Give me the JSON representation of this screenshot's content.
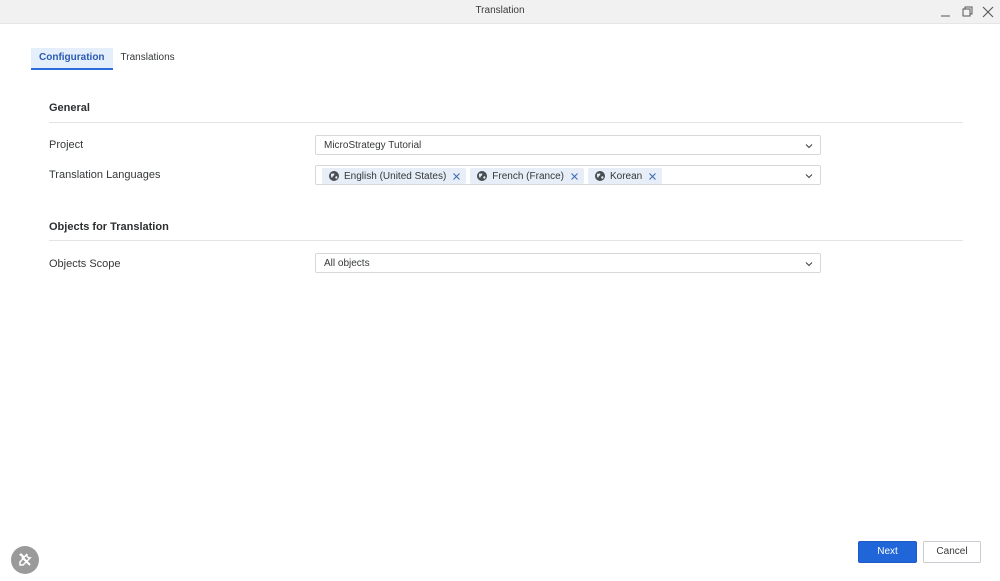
{
  "window": {
    "title": "Translation",
    "controls": [
      "minimize-icon",
      "restore-icon",
      "close-icon"
    ]
  },
  "tabs": [
    {
      "label": "Configuration",
      "active": true
    },
    {
      "label": "Translations",
      "active": false
    }
  ],
  "sections": {
    "general": {
      "title": "General",
      "project": {
        "label": "Project",
        "value": "MicroStrategy Tutorial"
      },
      "languages": {
        "label": "Translation Languages",
        "selected": [
          {
            "label": "English (United States)",
            "icon": "globe-icon"
          },
          {
            "label": "French (France)",
            "icon": "globe-icon"
          },
          {
            "label": "Korean",
            "icon": "globe-icon"
          }
        ]
      }
    },
    "objects": {
      "title": "Objects for Translation",
      "scope": {
        "label": "Objects Scope",
        "value": "All objects"
      }
    }
  },
  "footer": {
    "next_label": "Next",
    "cancel_label": "Cancel",
    "tool_icon": "tools-icon"
  },
  "colors": {
    "accent": "#2166d8",
    "tab_active_bg": "#e5eefb",
    "chip_bg": "#e8eef7"
  }
}
